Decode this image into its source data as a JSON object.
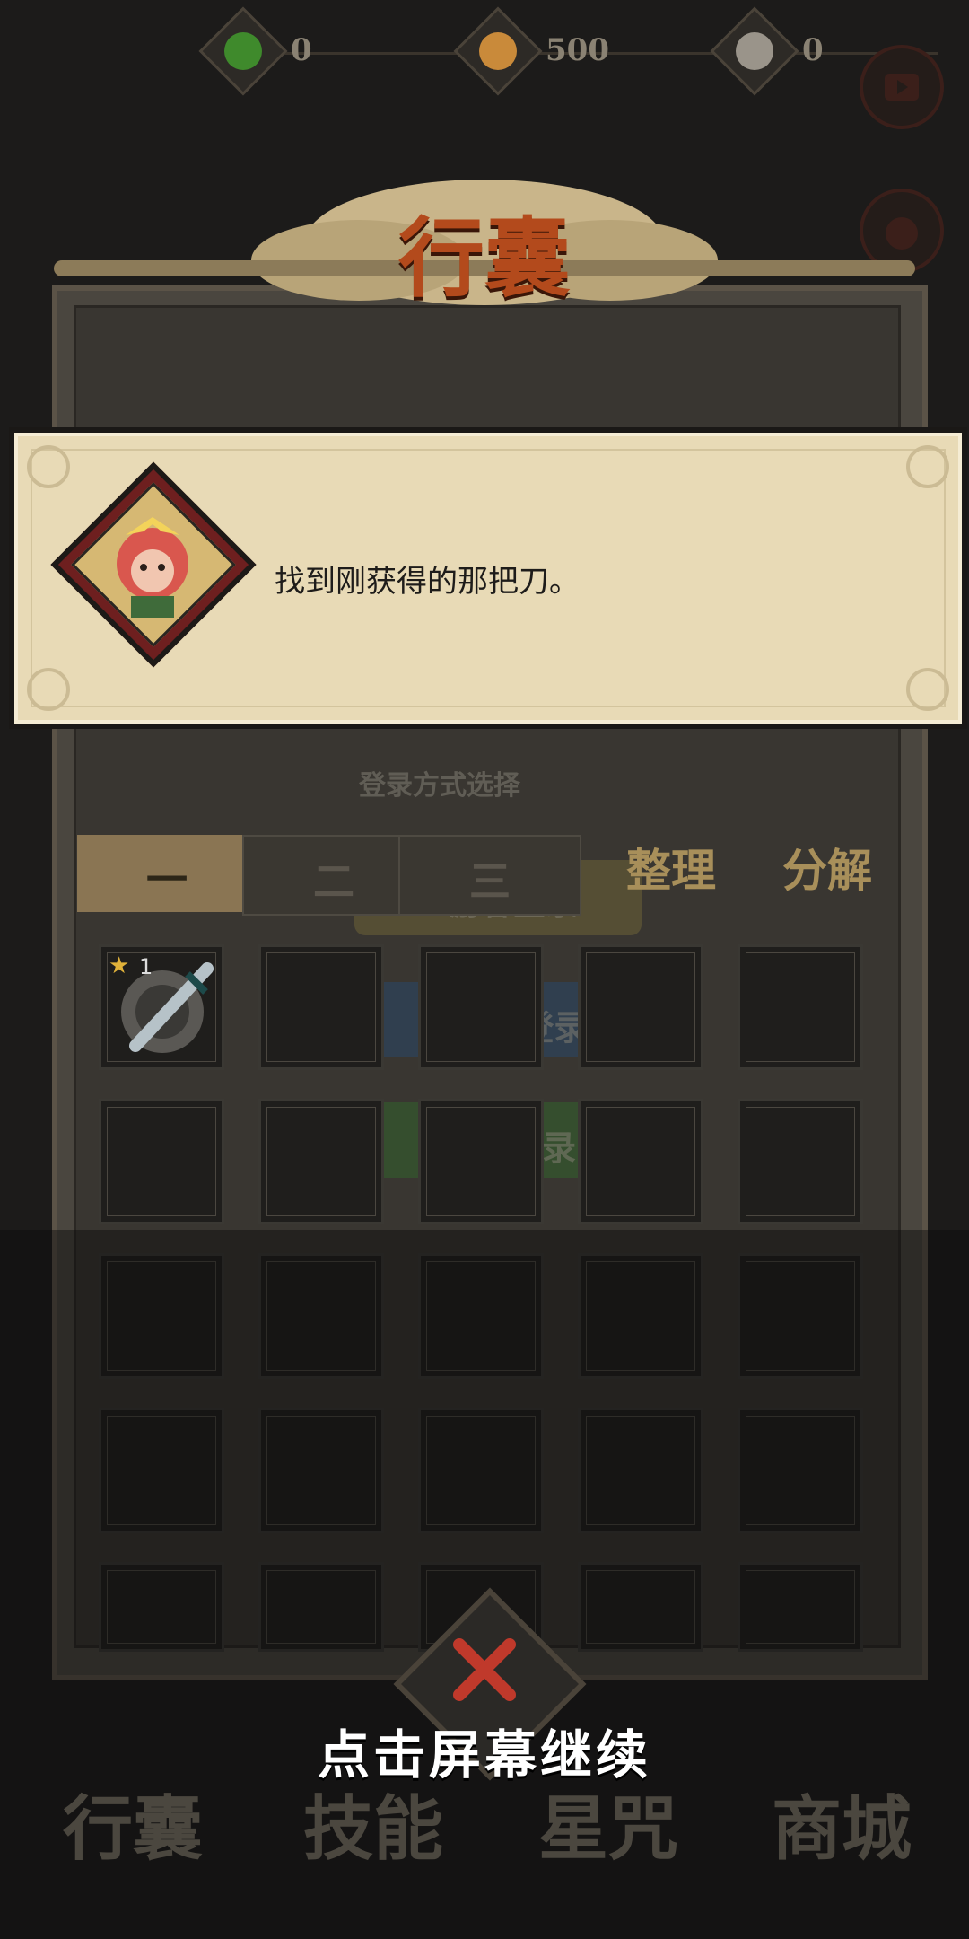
{
  "currencies": [
    {
      "name": "jade",
      "icon": "green-swirl-icon",
      "value": "0",
      "color": "#3f8a2c"
    },
    {
      "name": "coin",
      "icon": "copper-coin-icon",
      "value": "500",
      "color": "#c98a3a"
    },
    {
      "name": "spirit",
      "icon": "grey-swirl-icon",
      "value": "0",
      "color": "#9a948a"
    }
  ],
  "title": "行囊",
  "login_ghost": {
    "heading": "登录方式选择",
    "guest": "游客登录",
    "qq": "QQ 登录",
    "wechat": "微信登录"
  },
  "tabs": [
    {
      "label": "一",
      "active": true
    },
    {
      "label": "二",
      "active": false
    },
    {
      "label": "三",
      "active": false
    }
  ],
  "actions": {
    "sort": "整理",
    "decompose": "分解"
  },
  "inventory": {
    "rows": 5,
    "cols": 5,
    "items": [
      {
        "slot": 0,
        "icon": "sword-icon",
        "stars": "1"
      }
    ]
  },
  "dialog": {
    "avatar": "monkey-avatar-icon",
    "text": "找到刚获得的那把刀。"
  },
  "continue_text": "点击屏幕继续",
  "bottom_nav": [
    "行囊",
    "技能",
    "星咒",
    "商城"
  ],
  "colors": {
    "accent": "#8a7553",
    "dialog_bg": "#e8dab6",
    "close": "#c0392b"
  }
}
